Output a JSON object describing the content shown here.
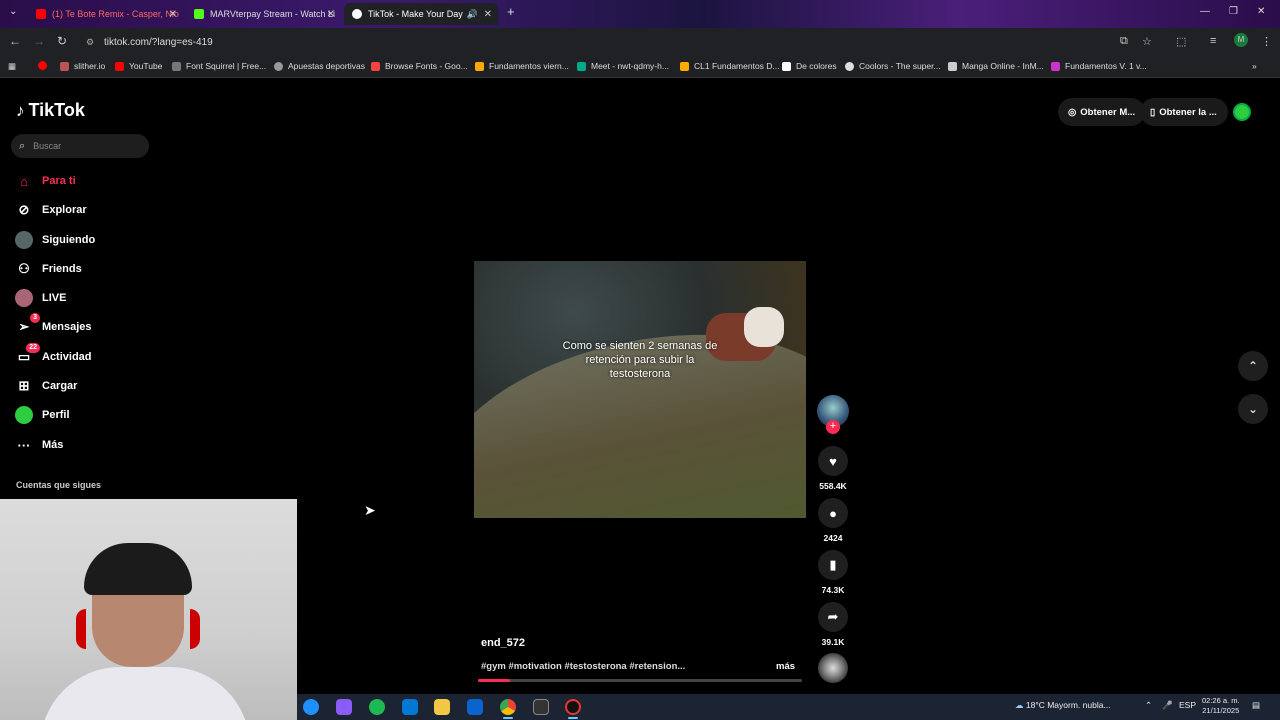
{
  "browser": {
    "tabs": [
      {
        "label": "(1) Te Bote Remix - Casper, Nio",
        "fav_color": "#ff0000"
      },
      {
        "label": "MARVterpay Stream - Watch Li",
        "fav_color": "#53fc18"
      },
      {
        "label": "TikTok - Make Your Day",
        "fav_color": "#ffffff"
      }
    ],
    "new_tab": "+",
    "url": "tiktok.com/?lang=es-419",
    "bookmarks": [
      "slither.io",
      "YouTube",
      "Font Squirrel | Free...",
      "Apuestas deportivas",
      "Browse Fonts - Goo...",
      "Fundamentos viern...",
      "Meet - nwt-qdmy-h...",
      "CL1 Fundamentos D...",
      "De colores",
      "Coolors - The super...",
      "Manga Online - InM...",
      "Fundamentos V. 1 v..."
    ]
  },
  "tiktok": {
    "logo": "TikTok",
    "search_placeholder": "Buscar",
    "nav": [
      {
        "label": "Para ti",
        "icon": "home-icon"
      },
      {
        "label": "Explorar",
        "icon": "compass-icon"
      },
      {
        "label": "Siguiendo",
        "icon": "following-avatar"
      },
      {
        "label": "Friends",
        "icon": "friends-icon"
      },
      {
        "label": "LIVE",
        "icon": "live-avatar"
      },
      {
        "label": "Mensajes",
        "icon": "send-icon",
        "badge": "3"
      },
      {
        "label": "Actividad",
        "icon": "inbox-icon",
        "badge": "22"
      },
      {
        "label": "Cargar",
        "icon": "upload-icon"
      },
      {
        "label": "Perfil",
        "icon": "profile-avatar"
      },
      {
        "label": "Más",
        "icon": "more-icon"
      }
    ],
    "following_title": "Cuentas que sigues",
    "top_buttons": [
      "Obtener M...",
      "Obtener la ..."
    ],
    "video": {
      "caption": "Como se sienten 2 semanas de retención para subir la testosterona",
      "author": "end_572",
      "description": "#gym #motivation #testosterona #retension...",
      "more": "más",
      "progress": 0.1
    },
    "actions": {
      "likes": "558.4K",
      "comments": "2424",
      "saves": "74.3K",
      "shares": "39.1K"
    }
  },
  "taskbar": {
    "weather": "18°C  Mayorm. nubla...",
    "lang": "ESP",
    "time": "02:26 a. m.",
    "date": "21/11/2025"
  },
  "colors": {
    "accent": "#fe2c55",
    "background": "#000000"
  }
}
